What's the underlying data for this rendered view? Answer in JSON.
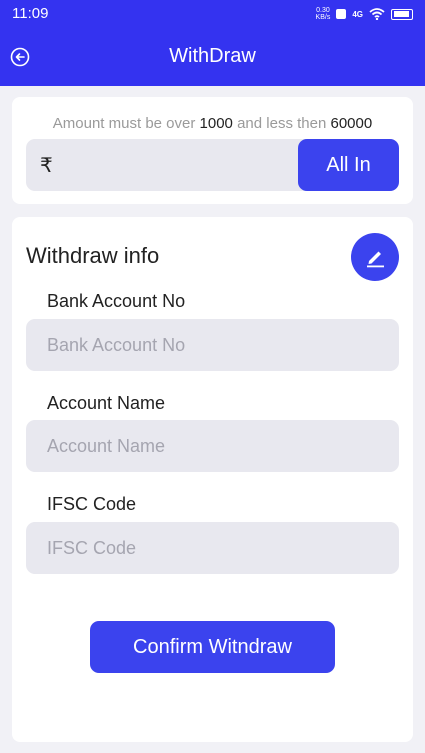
{
  "status_bar": {
    "time": "11:09",
    "net_speed_value": "0.30",
    "net_speed_unit": "KB/s",
    "network": "4G"
  },
  "header": {
    "title": "WithDraw"
  },
  "amount": {
    "hint_prefix": "Amount must be over",
    "min": "1000",
    "hint_middle": "and less then",
    "max": "60000",
    "currency_symbol": "₹",
    "all_in_label": "All In"
  },
  "withdraw_info": {
    "title": "Withdraw info",
    "fields": [
      {
        "label": "Bank Account No",
        "placeholder": "Bank Account No",
        "value": ""
      },
      {
        "label": "Account Name",
        "placeholder": "Account Name",
        "value": ""
      },
      {
        "label": "IFSC Code",
        "placeholder": "IFSC Code",
        "value": ""
      }
    ],
    "confirm_label": "Confirm Witndraw"
  },
  "colors": {
    "primary": "#3433f0",
    "button": "#3b43ee",
    "input_bg": "#e8e8ef",
    "page_bg": "#f1f1f6"
  }
}
